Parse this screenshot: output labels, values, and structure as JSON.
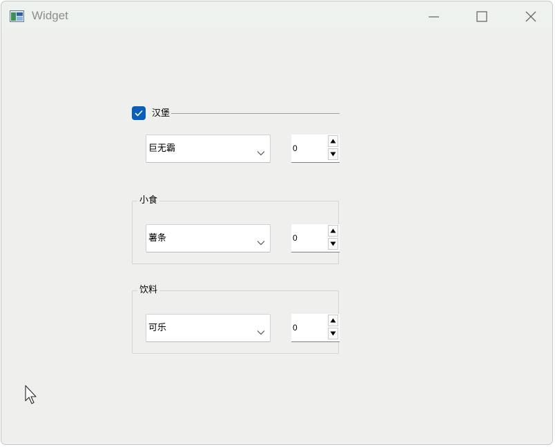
{
  "window": {
    "title": "Widget",
    "icon": "app-window-icon",
    "controls": {
      "minimize_icon": "minimize-icon",
      "maximize_icon": "maximize-icon",
      "close_icon": "close-icon"
    }
  },
  "burger": {
    "label": "汉堡",
    "checked": true,
    "combo_value": "巨无霸",
    "spin_value": "0"
  },
  "snack": {
    "label": "小食",
    "combo_value": "薯条",
    "spin_value": "0"
  },
  "drink": {
    "label": "饮料",
    "combo_value": "可乐",
    "spin_value": "0"
  },
  "colors": {
    "accent": "#0b5fb8",
    "window_bg": "#eff0ee",
    "titlebar_bg": "#eef2ef"
  }
}
